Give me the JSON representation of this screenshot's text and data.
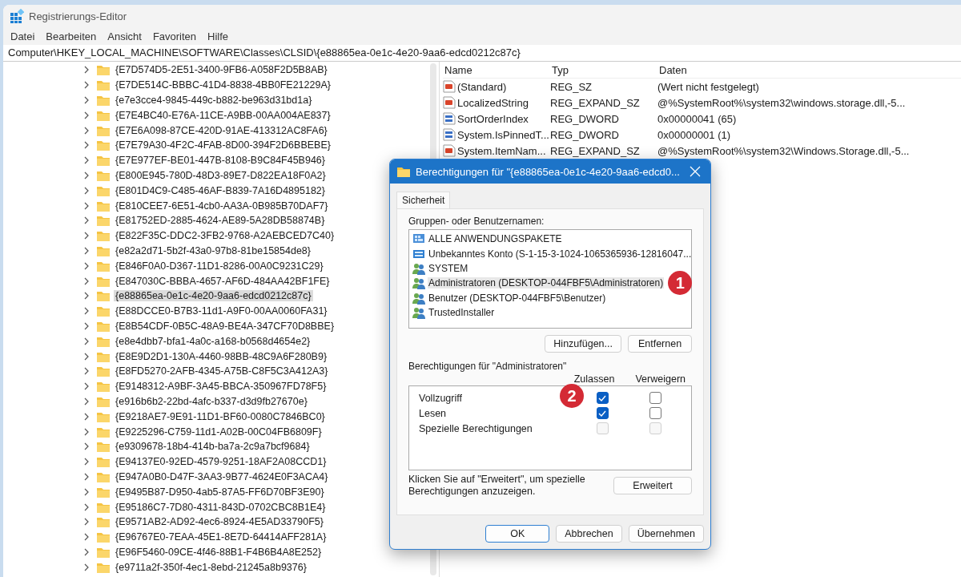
{
  "window": {
    "title": "Registrierungs-Editor"
  },
  "menu": [
    "Datei",
    "Bearbeiten",
    "Ansicht",
    "Favoriten",
    "Hilfe"
  ],
  "address": "Computer\\HKEY_LOCAL_MACHINE\\SOFTWARE\\Classes\\CLSID\\{e88865ea-0e1c-4e20-9aa6-edcd0212c87c}",
  "tree": [
    {
      "label": "{E7D574D5-2E51-3400-9FB6-A058F2D5B8AB}",
      "selected": false
    },
    {
      "label": "{E7DE514C-BBBC-41D4-8838-4BB0FE21229A}",
      "selected": false
    },
    {
      "label": "{e7e3cce4-9845-449c-b882-be963d31bd1a}",
      "selected": false
    },
    {
      "label": "{E7E4BC40-E76A-11CE-A9BB-00AA004AE837}",
      "selected": false
    },
    {
      "label": "{E7E6A098-87CE-420D-91AE-413312AC8FA6}",
      "selected": false
    },
    {
      "label": "{E7E79A30-4F2C-4FAB-8D00-394F2D6BBEBE}",
      "selected": false
    },
    {
      "label": "{E7E977EF-BE01-447B-8108-B9C84F45B946}",
      "selected": false
    },
    {
      "label": "{E800E945-780D-48D3-89E7-D822EA18F0A2}",
      "selected": false
    },
    {
      "label": "{E801D4C9-C485-46AF-B839-7A16D4895182}",
      "selected": false
    },
    {
      "label": "{E810CEE7-6E51-4cb0-AA3A-0B985B70DAF7}",
      "selected": false
    },
    {
      "label": "{E81752ED-2885-4624-AE89-5A28DB58874B}",
      "selected": false
    },
    {
      "label": "{E822F35C-DDC2-3FB2-9768-A2AEBCED7C40}",
      "selected": false
    },
    {
      "label": "{e82a2d71-5b2f-43a0-97b8-81be15854de8}",
      "selected": false
    },
    {
      "label": "{E846F0A0-D367-11D1-8286-00A0C9231C29}",
      "selected": false
    },
    {
      "label": "{E847030C-BBBA-4657-AF6D-484AA42BF1FE}",
      "selected": false
    },
    {
      "label": "{e88865ea-0e1c-4e20-9aa6-edcd0212c87c}",
      "selected": true
    },
    {
      "label": "{E88DCCE0-B7B3-11d1-A9F0-00AA0060FA31}",
      "selected": false
    },
    {
      "label": "{E8B54CDF-0B5C-48A9-BE4A-347CF70D8BBE}",
      "selected": false
    },
    {
      "label": "{e8e4dbb7-bfa1-4a0c-a168-b0568d4654e2}",
      "selected": false
    },
    {
      "label": "{E8E9D2D1-130A-4460-98BB-48C9A6F280B9}",
      "selected": false
    },
    {
      "label": "{E8FD5270-2AFB-4345-A75B-C8F5C3A412A3}",
      "selected": false
    },
    {
      "label": "{E9148312-A9BF-3A45-BBCA-350967FD78F5}",
      "selected": false
    },
    {
      "label": "{e916b6b2-22bd-4afc-b337-d3d9fb27670e}",
      "selected": false
    },
    {
      "label": "{E9218AE7-9E91-11D1-BF60-0080C7846BC0}",
      "selected": false
    },
    {
      "label": "{E9225296-C759-11d1-A02B-00C04FB6809F}",
      "selected": false
    },
    {
      "label": "{e9309678-18b4-414b-ba7a-2c9a7bcf9684}",
      "selected": false
    },
    {
      "label": "{E94137E0-92ED-4579-9251-18AF2A08CCD1}",
      "selected": false
    },
    {
      "label": "{E947A0B0-D47F-3AA3-9B77-4624E0F3ACA4}",
      "selected": false
    },
    {
      "label": "{E9495B87-D950-4ab5-87A5-FF6D70BF3E90}",
      "selected": false
    },
    {
      "label": "{E95186C7-7D80-4311-843D-0702CBC8B1E4}",
      "selected": false
    },
    {
      "label": "{E9571AB2-AD92-4ec6-8924-4E5AD33790F5}",
      "selected": false
    },
    {
      "label": "{E96767E0-7EAA-45E1-8E7D-64414AFF281A}",
      "selected": false
    },
    {
      "label": "{E96F5460-09CE-4f46-88B1-F4B6B4A8E252}",
      "selected": false
    },
    {
      "label": "{e9711a2f-350f-4ec1-8ebd-21245a8b9376}",
      "selected": false
    }
  ],
  "values": {
    "columns": [
      "Name",
      "Typ",
      "Daten"
    ],
    "rows": [
      {
        "kind": "string",
        "name": "(Standard)",
        "type": "REG_SZ",
        "data": "(Wert nicht festgelegt)"
      },
      {
        "kind": "string",
        "name": "LocalizedString",
        "type": "REG_EXPAND_SZ",
        "data": "@%SystemRoot%\\system32\\windows.storage.dll,-5..."
      },
      {
        "kind": "dword",
        "name": "SortOrderIndex",
        "type": "REG_DWORD",
        "data": "0x00000041 (65)"
      },
      {
        "kind": "dword",
        "name": "System.IsPinnedT...",
        "type": "REG_DWORD",
        "data": "0x00000001 (1)"
      },
      {
        "kind": "string",
        "name": "System.ItemNam...",
        "type": "REG_EXPAND_SZ",
        "data": "@%SystemRoot%\\system32\\Windows.Storage.dll,-5..."
      }
    ]
  },
  "dialog": {
    "title": "Berechtigungen für \"{e88865ea-0e1c-4e20-9aa6-edcd0...",
    "tabs": [
      {
        "label": "Sicherheit",
        "selected": true
      }
    ],
    "users_label": "Gruppen- oder Benutzernamen:",
    "users": [
      {
        "kind": "package",
        "name": "ALLE ANWENDUNGSPAKETE",
        "selected": false
      },
      {
        "kind": "account",
        "name": "Unbekanntes Konto (S-1-15-3-1024-1065365936-12816047...",
        "selected": false
      },
      {
        "kind": "group",
        "name": "SYSTEM",
        "selected": false
      },
      {
        "kind": "group",
        "name": "Administratoren (DESKTOP-044FBF5\\Administratoren)",
        "selected": true,
        "annotation": "1"
      },
      {
        "kind": "group",
        "name": "Benutzer (DESKTOP-044FBF5\\Benutzer)",
        "selected": false
      },
      {
        "kind": "group",
        "name": "TrustedInstaller",
        "selected": false
      }
    ],
    "user_buttons": [
      "Hinzufügen...",
      "Entfernen"
    ],
    "permissions_label": "Berechtigungen für \"Administratoren\"",
    "permission_columns": [
      "Zulassen",
      "Verweigern"
    ],
    "permissions": [
      {
        "name": "Vollzugriff",
        "allow": {
          "checked": true,
          "disabled": false
        },
        "deny": {
          "checked": false,
          "disabled": false
        },
        "annotation": "2"
      },
      {
        "name": "Lesen",
        "allow": {
          "checked": true,
          "disabled": false
        },
        "deny": {
          "checked": false,
          "disabled": false
        }
      },
      {
        "name": "Spezielle Berechtigungen",
        "allow": {
          "checked": false,
          "disabled": true
        },
        "deny": {
          "checked": false,
          "disabled": true
        }
      }
    ],
    "hint": "Klicken Sie auf \"Erweitert\", um spezielle Berechtigungen anzuzeigen.",
    "advanced_button": "Erweitert",
    "buttons": [
      {
        "label": "OK",
        "default": true
      },
      {
        "label": "Abbrechen",
        "default": false
      },
      {
        "label": "Übernehmen",
        "default": false
      }
    ]
  }
}
